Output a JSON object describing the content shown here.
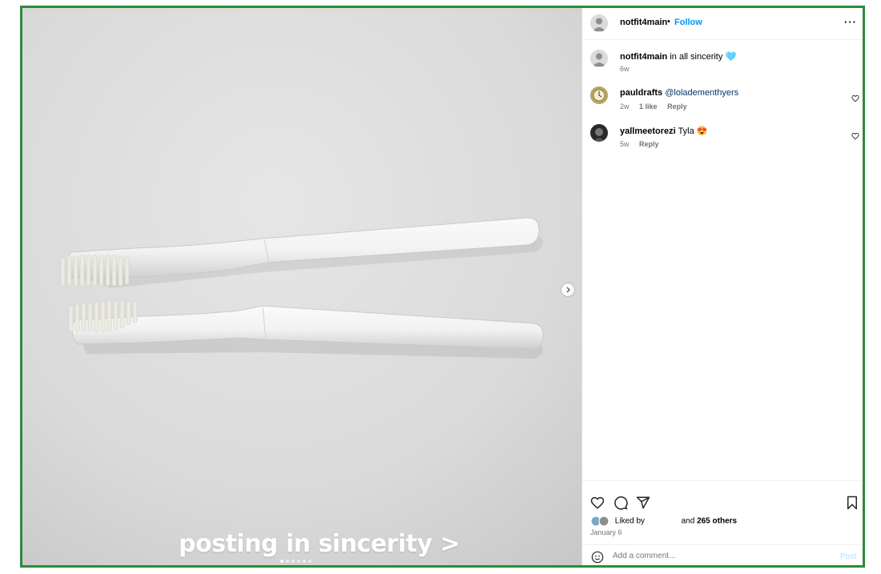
{
  "post": {
    "overlay_caption": "posting in sincerity >",
    "carousel_count": 6,
    "carousel_active": 0
  },
  "header": {
    "username": "notfit4main",
    "separator": "•",
    "follow_label": "Follow",
    "more_label": "···"
  },
  "caption": {
    "username": "notfit4main",
    "text": "in all sincerity",
    "emoji": "🩵",
    "age": "6w"
  },
  "comments": [
    {
      "username": "pauldrafts",
      "mention": "@loladementhyers",
      "text": "",
      "age": "2w",
      "likes": "1 like",
      "reply_label": "Reply"
    },
    {
      "username": "yallmeetorezi",
      "mention": "",
      "text": "Tyla 😍",
      "age": "5w",
      "likes": "",
      "reply_label": "Reply"
    }
  ],
  "footer": {
    "liked_by_prefix": "Liked by",
    "liked_by_suffix": "and",
    "others": "265 others",
    "date": "January 6",
    "add_comment_placeholder": "Add a comment...",
    "post_label": "Post"
  },
  "colors": {
    "frame_border": "#2e8b3a",
    "link_blue": "#0095f6",
    "mention_blue": "#00376b",
    "post_disabled": "#b2dffc"
  }
}
